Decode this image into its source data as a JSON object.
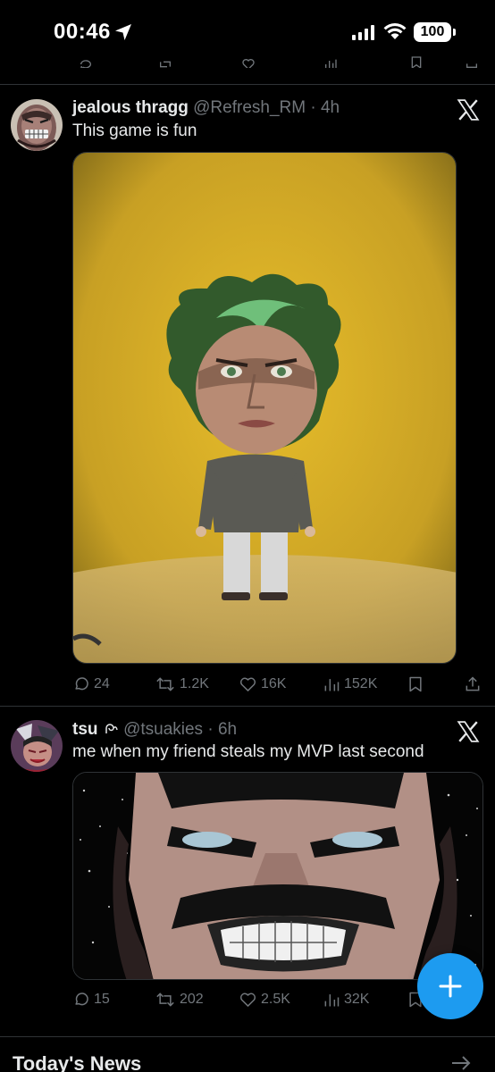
{
  "status_bar": {
    "time": "00:46",
    "battery": "100"
  },
  "tweets": [
    {
      "name": "jealous thragg",
      "handle": "@Refresh_RM",
      "age": "4h",
      "text": "This game is fun",
      "replies": "24",
      "retweets": "1.2K",
      "likes": "16K",
      "views": "152K"
    },
    {
      "name": "tsu",
      "handle": "@tsuakies",
      "age": "6h",
      "text": "me when my friend steals my MVP last second",
      "replies": "15",
      "retweets": "202",
      "likes": "2.5K",
      "views": "32K"
    }
  ],
  "section": {
    "title": "Today's News"
  },
  "icons": {
    "reply": "reply-icon",
    "retweet": "retweet-icon",
    "like": "heart-icon",
    "views": "views-icon",
    "bookmark": "bookmark-icon",
    "share": "share-icon",
    "compose": "plus-icon",
    "brand": "x-logo-icon"
  },
  "colors": {
    "accent": "#1d9bf0",
    "background": "#000000",
    "muted": "#71767b"
  }
}
